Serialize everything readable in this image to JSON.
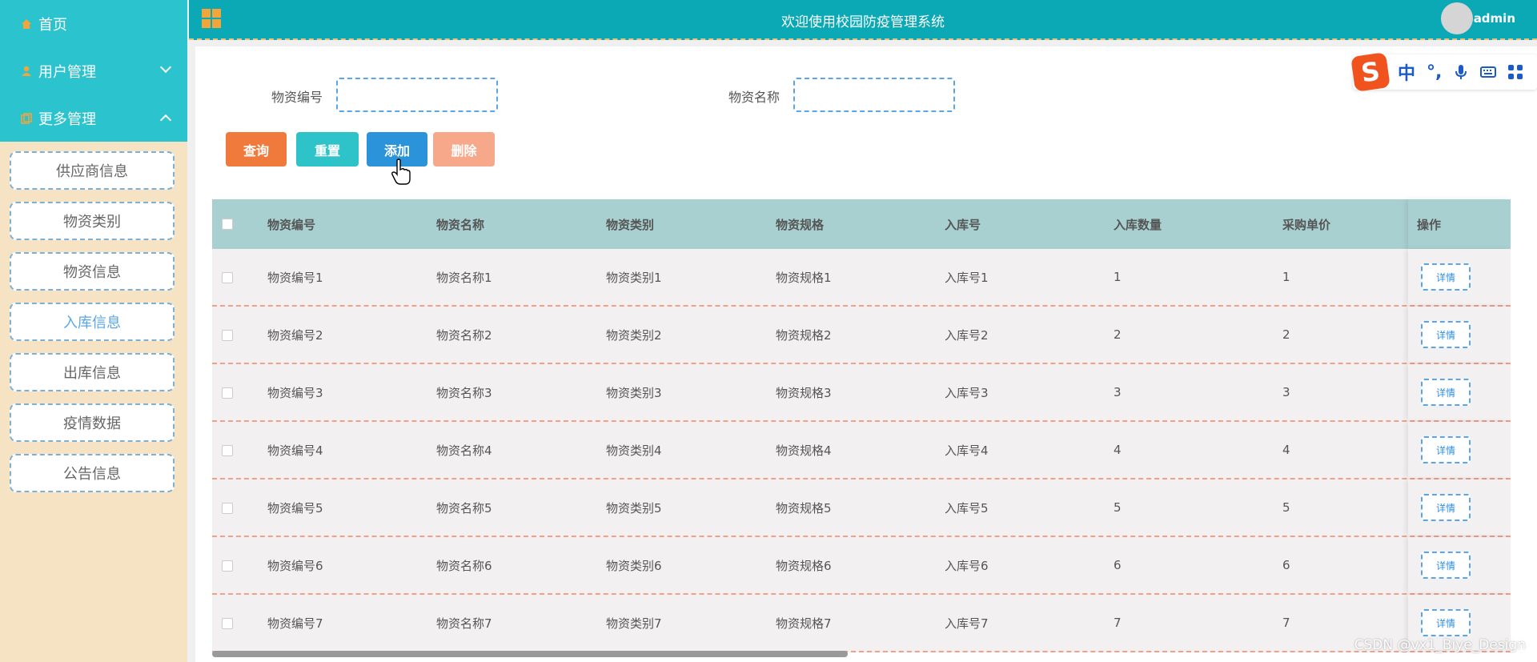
{
  "sidebar": {
    "menus": [
      {
        "label": "首页",
        "icon": "home-icon"
      },
      {
        "label": "用户管理",
        "icon": "user-icon"
      },
      {
        "label": "更多管理",
        "icon": "copy-icon"
      }
    ],
    "items": [
      {
        "label": "供应商信息"
      },
      {
        "label": "物资类别"
      },
      {
        "label": "物资信息"
      },
      {
        "label": "入库信息",
        "active": true
      },
      {
        "label": "出库信息"
      },
      {
        "label": "疫情数据"
      },
      {
        "label": "公告信息"
      }
    ]
  },
  "header": {
    "title": "欢迎使用校园防疫管理系统",
    "username": "admin"
  },
  "ime": {
    "logo": "S",
    "lang": "中",
    "punct": "°,"
  },
  "search": {
    "field1_label": "物资编号",
    "field2_label": "物资名称",
    "field1_value": "",
    "field2_value": ""
  },
  "buttons": {
    "query": "查询",
    "reset": "重置",
    "add": "添加",
    "delete": "删除"
  },
  "colors": {
    "query": "#ef7a3b",
    "reset": "#2ec2c9",
    "add": "#2b93d9",
    "delete": "#f7a88b"
  },
  "table": {
    "headers": [
      "物资编号",
      "物资名称",
      "物资类别",
      "物资规格",
      "入库号",
      "入库数量",
      "采购单价",
      "操作"
    ],
    "detail_label": "详情",
    "rows": [
      [
        "物资编号1",
        "物资名称1",
        "物资类别1",
        "物资规格1",
        "入库号1",
        "1",
        "1"
      ],
      [
        "物资编号2",
        "物资名称2",
        "物资类别2",
        "物资规格2",
        "入库号2",
        "2",
        "2"
      ],
      [
        "物资编号3",
        "物资名称3",
        "物资类别3",
        "物资规格3",
        "入库号3",
        "3",
        "3"
      ],
      [
        "物资编号4",
        "物资名称4",
        "物资类别4",
        "物资规格4",
        "入库号4",
        "4",
        "4"
      ],
      [
        "物资编号5",
        "物资名称5",
        "物资类别5",
        "物资规格5",
        "入库号5",
        "5",
        "5"
      ],
      [
        "物资编号6",
        "物资名称6",
        "物资类别6",
        "物资规格6",
        "入库号6",
        "6",
        "6"
      ],
      [
        "物资编号7",
        "物资名称7",
        "物资类别7",
        "物资规格7",
        "入库号7",
        "7",
        "7"
      ]
    ]
  },
  "watermark": "CSDN @vx1_Biye_Design"
}
